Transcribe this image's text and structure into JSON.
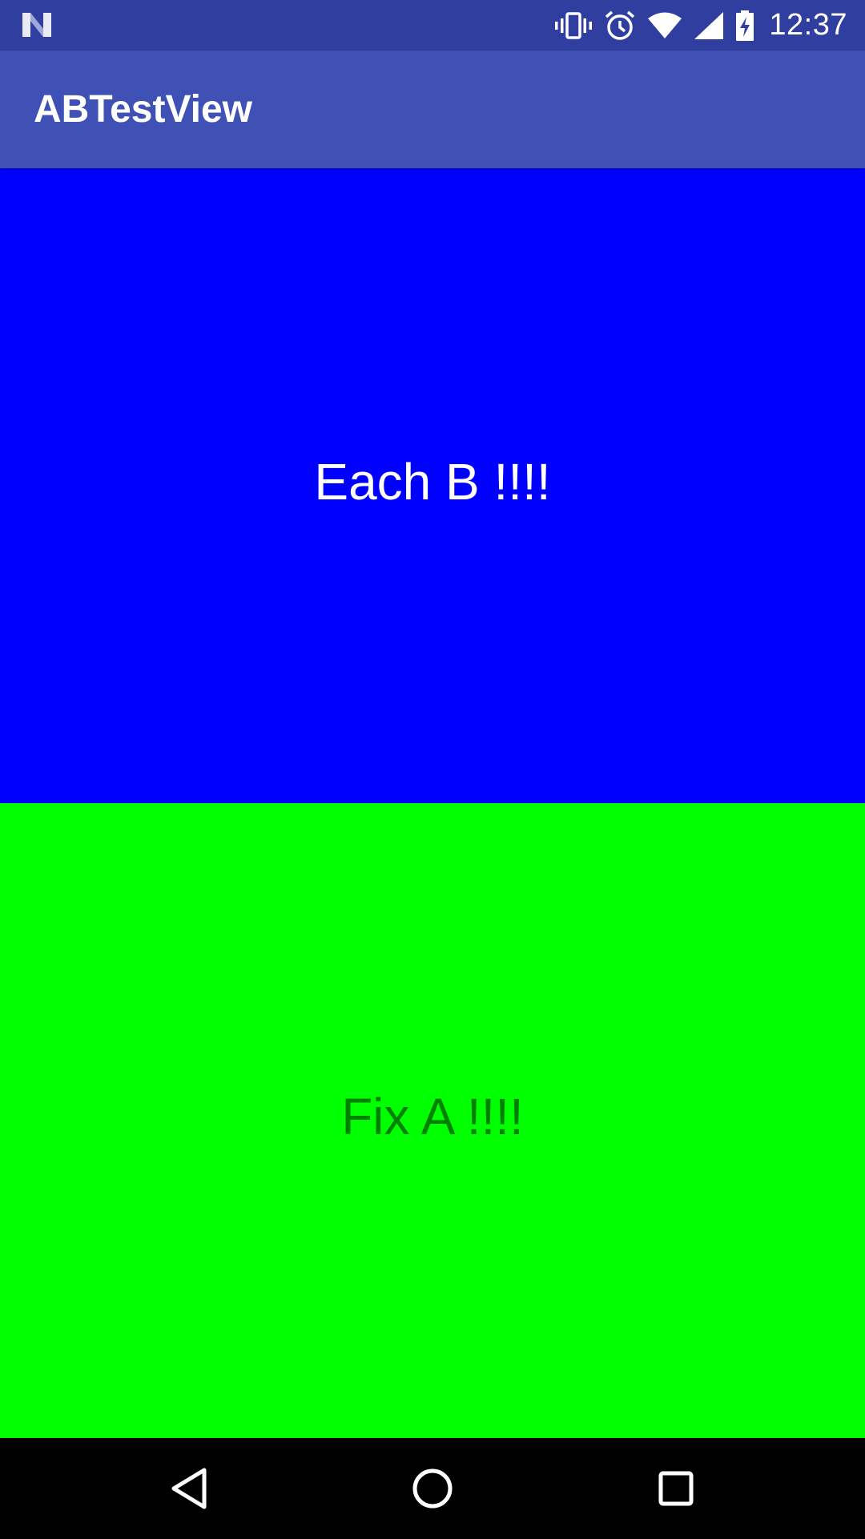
{
  "status_bar": {
    "time": "12:37",
    "icons": [
      "notification-n-icon",
      "vibrate-icon",
      "alarm-icon",
      "wifi-icon",
      "signal-icon",
      "battery-charging-icon"
    ],
    "background": "#303f9f"
  },
  "app_bar": {
    "title": "ABTestView",
    "background": "#3f51b5"
  },
  "view_b": {
    "label": "Each B !!!!",
    "background": "#0000ff",
    "text_color": "#ffffff"
  },
  "view_a": {
    "label": "Fix A !!!!",
    "background": "#00ff00",
    "text_color": "#008000"
  },
  "nav_bar": {
    "icons": [
      "back-icon",
      "home-icon",
      "recent-apps-icon"
    ],
    "background": "#000000"
  }
}
